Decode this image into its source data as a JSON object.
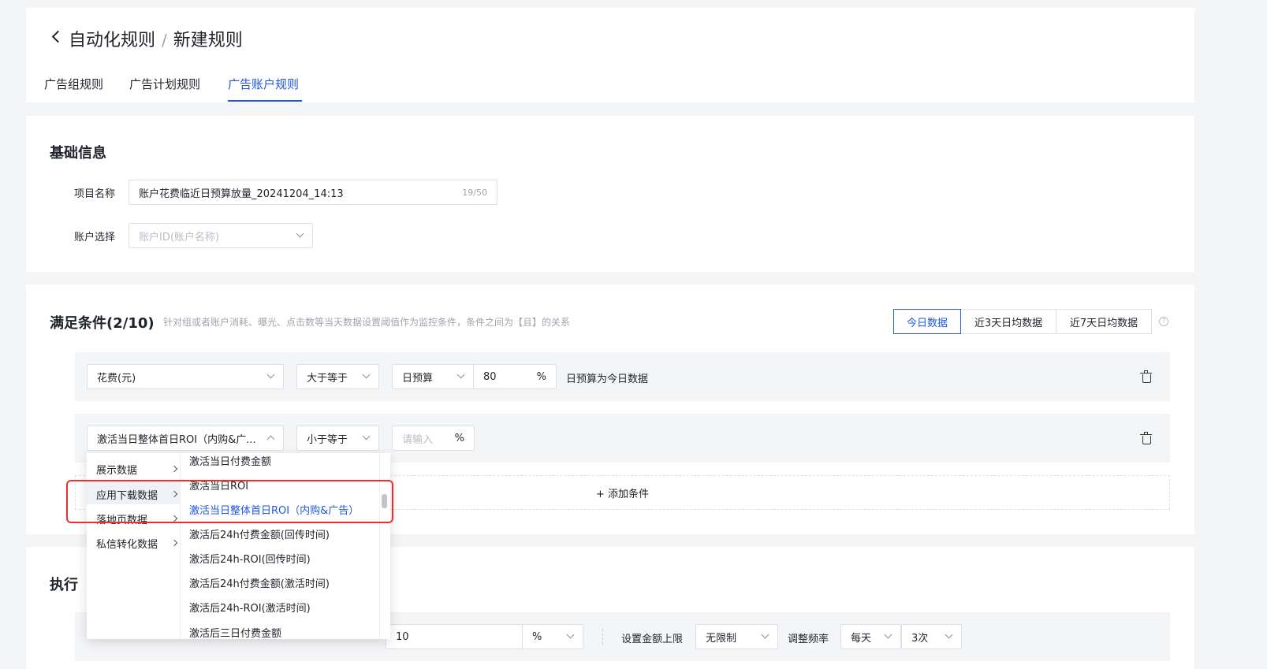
{
  "header": {
    "title": "自动化规则",
    "separator": "/",
    "subtitle": "新建规则",
    "tabs": [
      {
        "label": "广告组规则",
        "active": false
      },
      {
        "label": "广告计划规则",
        "active": false
      },
      {
        "label": "广告账户规则",
        "active": true
      }
    ]
  },
  "basic": {
    "section_title": "基础信息",
    "project_label": "项目名称",
    "project_value": "账户花费临近日预算放量_20241204_14:13",
    "project_count": "19/50",
    "account_label": "账户选择",
    "account_placeholder": "账户ID(账户名称)"
  },
  "conditions": {
    "section_title": "满足条件(2/10)",
    "hint": "针对组或者账户消耗、曝光、点击数等当天数据设置阈值作为监控条件，条件之间为【且】的关系",
    "range_tabs": [
      {
        "label": "今日数据",
        "active": true
      },
      {
        "label": "近3天日均数据",
        "active": false
      },
      {
        "label": "近7天日均数据",
        "active": false
      }
    ],
    "row1": {
      "metric": "花费(元)",
      "operator": "大于等于",
      "base": "日预算",
      "value": "80",
      "unit": "%",
      "note": "日预算为今日数据"
    },
    "row2": {
      "metric": "激活当日整体首日ROI（内购&广...",
      "operator": "小于等于",
      "value_placeholder": "请输入",
      "unit": "%"
    },
    "add_label": "+ 添加条件"
  },
  "dropdown": {
    "categories": [
      "展示数据",
      "应用下载数据",
      "落地页数据",
      "私信转化数据"
    ],
    "options": [
      "激活当日付费金额",
      "激活当日ROI",
      "激活当日整体首日ROI（内购&广告）",
      "激活后24h付费金额(回传时间)",
      "激活后24h-ROI(回传时间)",
      "激活后24h付费金额(激活时间)",
      "激活后24h-ROI(激活时间)",
      "激活后三日付费金额"
    ]
  },
  "execution": {
    "section_title": "执行",
    "value": "10",
    "unit": "%",
    "limit_label": "设置金额上限",
    "limit_value": "无限制",
    "freq_label": "调整频率",
    "freq_value": "每天",
    "times_value": "3次"
  },
  "colors": {
    "accent": "#1f57e0",
    "highlight_box": "#e8322f"
  }
}
